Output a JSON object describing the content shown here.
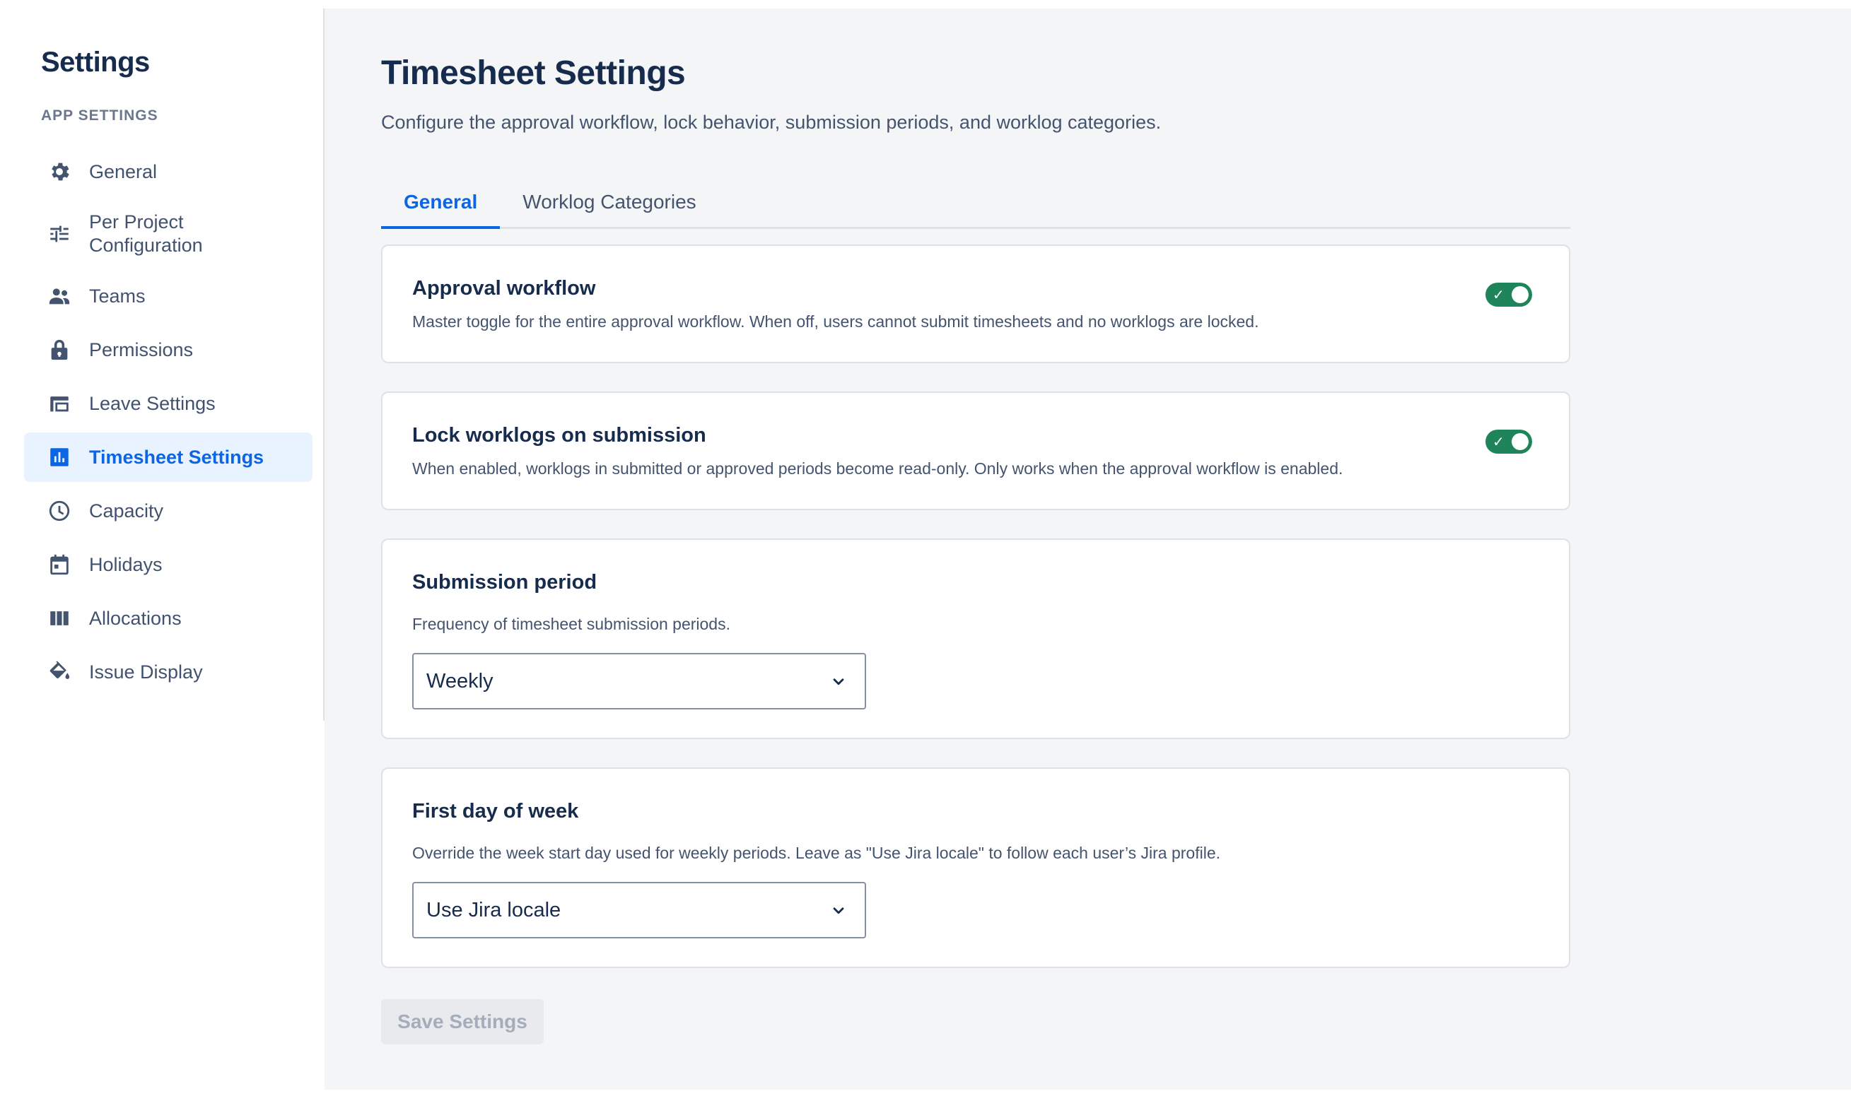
{
  "sidebar": {
    "title": "Settings",
    "section_label": "APP SETTINGS",
    "items": [
      {
        "label": "General",
        "icon": "gear-icon"
      },
      {
        "label": "Per Project Configuration",
        "icon": "sliders-icon"
      },
      {
        "label": "Teams",
        "icon": "people-icon"
      },
      {
        "label": "Permissions",
        "icon": "lock-icon"
      },
      {
        "label": "Leave Settings",
        "icon": "window-icon"
      },
      {
        "label": "Timesheet Settings",
        "icon": "bar-chart-icon",
        "active": true
      },
      {
        "label": "Capacity",
        "icon": "clock-icon"
      },
      {
        "label": "Holidays",
        "icon": "calendar-icon"
      },
      {
        "label": "Allocations",
        "icon": "columns-icon"
      },
      {
        "label": "Issue Display",
        "icon": "paint-bucket-icon"
      }
    ]
  },
  "main": {
    "title": "Timesheet Settings",
    "description": "Configure the approval workflow, lock behavior, submission periods, and worklog categories.",
    "tabs": [
      {
        "label": "General",
        "active": true
      },
      {
        "label": "Worklog Categories",
        "active": false
      }
    ],
    "cards": {
      "approval": {
        "title": "Approval workflow",
        "description": "Master toggle for the entire approval workflow. When off, users cannot submit timesheets and no worklogs are locked.",
        "enabled": true
      },
      "lock": {
        "title": "Lock worklogs on submission",
        "description": "When enabled, worklogs in submitted or approved periods become read-only. Only works when the approval workflow is enabled.",
        "enabled": true
      },
      "period": {
        "title": "Submission period",
        "description": "Frequency of timesheet submission periods.",
        "selected": "Weekly"
      },
      "first_day": {
        "title": "First day of week",
        "description": "Override the week start day used for weekly periods. Leave as \"Use Jira locale\" to follow each user’s Jira profile.",
        "selected": "Use Jira locale"
      }
    },
    "save_label": "Save Settings"
  },
  "colors": {
    "accent": "#0c66e4",
    "toggle_on": "#1f845a",
    "active_bg": "#e9f2ff"
  }
}
